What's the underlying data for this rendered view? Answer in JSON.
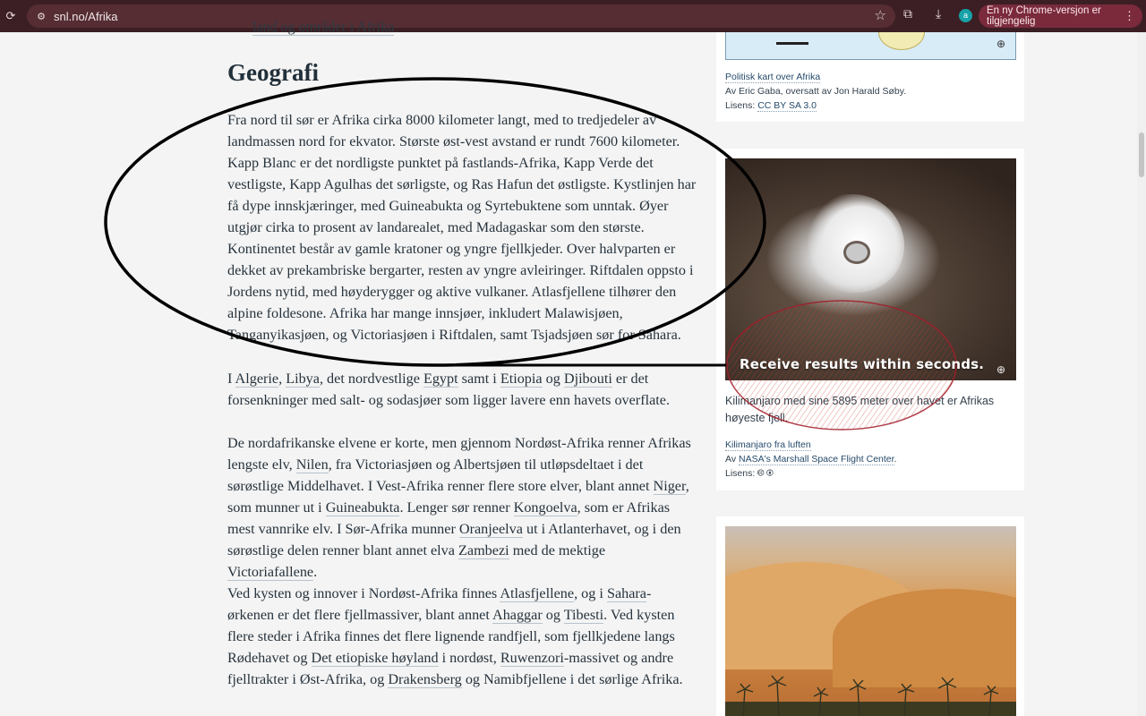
{
  "browser": {
    "url": "snl.no/Afrika",
    "update_label": "En ny Chrome-versjon er tilgjengelig",
    "profile_initial": "a",
    "icons": [
      "reload-icon",
      "site-settings-icon",
      "bookmark-star-icon",
      "extensions-icon",
      "download-icon",
      "more-menu-icon"
    ]
  },
  "article": {
    "cut_line_link": "land og områder i Afrika",
    "heading": "Geografi",
    "p1": {
      "t1": "Fra nord til sør er Afrika cirka 8000 kilometer langt, med to tredjedeler av landmassen nord for ekvator. Største øst-vest avstand er rundt 7600 kilometer. Kapp Blanc er det nordligste punktet på fastlands-Afrika, Kapp Verde det vestligste, Kapp Agulhas det sørligste, og Ras Hafun det østligste. Kystlinjen har få dype innskjæringer, med Guineabukta og Syrtebuktene som unntak. Øyer utgjør cirka to prosent av landarealet, med Madagaskar som den største. Kontinentet består av gamle kratoner og yngre fjellkjeder. Over halvparten er dekket av prekambriske bergarter, resten av yngre avleiringer. Riftdalen oppsto i Jordens nytid, med høyderygger og aktive vulkaner. Atlasfjellene tilhører den alpine foldesone. Afrika har mange innsjøer, inkludert Malawisjøen, Tanganyikasjøen, og Victoriasjøen i Riftdalen, samt Tsjadsjøen sør for Sahara."
    },
    "p2": {
      "t1": "I ",
      "l1": "Algerie",
      "t2": ", ",
      "l2": "Libya",
      "t3": ", det nordvestlige ",
      "l3": "Egypt",
      "t4": " samt i ",
      "l4": "Etiopia",
      "t5": " og ",
      "l5": "Djibouti",
      "t6": " er det forsenkninger med salt- og sodasjøer som ligger lavere enn havets overflate."
    },
    "p3": {
      "t1": "De nordafrikanske elvene er korte, men gjennom Nordøst-Afrika renner Afrikas lengste elv, ",
      "l1": "Nilen",
      "t2": ", fra Victoriasjøen og Albertsjøen til utløpsdeltaet i det sørøstlige Middelhavet. I Vest-Afrika renner flere store elver, blant annet ",
      "l2": "Niger",
      "t3": ", som munner ut i ",
      "l3": "Guineabukta",
      "t4": ". Lenger sør renner ",
      "l4": "Kongoelva",
      "t5": ", som er Afrikas mest vannrike elv. I Sør-Afrika munner ",
      "l5": "Oranjeelva",
      "t6": " ut i Atlanterhavet, og i den sørøstlige delen renner blant annet elva ",
      "l6": "Zambezi",
      "t7": " med de mektige ",
      "l7": "Victoriafallene",
      "t8": "."
    },
    "p4": {
      "t1": "Ved kysten og innover i Nordøst-Afrika finnes ",
      "l1": "Atlasfjellene",
      "t2": ", og i ",
      "l2": "Sahara",
      "t3": "-ørkenen er det flere fjellmassiver, blant annet ",
      "l3": "Ahaggar",
      "t4": " og ",
      "l4": "Tibesti",
      "t5": ". Ved kysten flere steder i Afrika finnes det flere lignende randfjell, som fjellkjedene langs Rødehavet og ",
      "l5": "Det etiopiske høyland",
      "t6": " i nordøst, ",
      "l6": "Ruwenzori",
      "t7": "-massivet og andre fjelltrakter i Øst-Afrika, og ",
      "l7": "Drakensberg",
      "t8": " og Namibfjellene i det sørlige Afrika."
    }
  },
  "sidebar": {
    "map_card": {
      "title_link": "Politisk kart over Afrika",
      "byline": "Av Eric Gaba, oversatt av Jon Harald Søby.",
      "license_prefix": "Lisens: ",
      "license_link": "CC BY SA 3.0"
    },
    "kili_card": {
      "caption": "Kilimanjaro med sine 5895 meter over havet er Afrikas høyeste fjell.",
      "title_link": "Kilimanjaro fra luften",
      "byline_prefix": "Av ",
      "byline_link": "NASA's Marshall Space Flight Center",
      "byline_suffix": ".",
      "license_prefix": "Lisens: ",
      "license_badges": "🅭 🅯"
    }
  },
  "overlay": {
    "promo_text": "Receive results within seconds.",
    "colors": {
      "ellipse": "#000000",
      "scribble": "#c0392b"
    }
  }
}
